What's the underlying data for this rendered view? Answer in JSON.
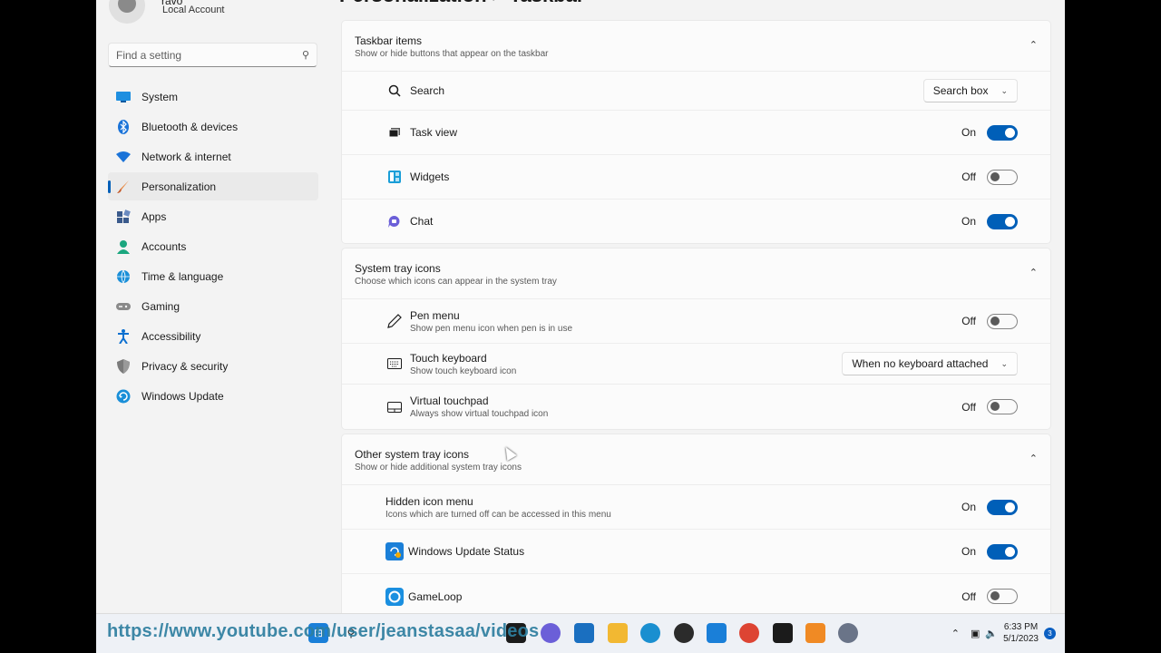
{
  "account": {
    "name": "ravo",
    "type": "Local Account"
  },
  "page_title": "Personalization  >  Taskbar",
  "search": {
    "placeholder": "Find a setting"
  },
  "sidebar": {
    "items": [
      {
        "label": "System",
        "icon": "monitor-icon",
        "color": "#0078d4"
      },
      {
        "label": "Bluetooth & devices",
        "icon": "bluetooth-icon",
        "color": "#0078d4"
      },
      {
        "label": "Network & internet",
        "icon": "wifi-icon",
        "color": "#0078d4"
      },
      {
        "label": "Personalization",
        "icon": "brush-icon",
        "color": "#e8833a",
        "active": true
      },
      {
        "label": "Apps",
        "icon": "apps-icon",
        "color": "#3a5a8c"
      },
      {
        "label": "Accounts",
        "icon": "person-icon",
        "color": "#1aa67e"
      },
      {
        "label": "Time & language",
        "icon": "globe-clock-icon",
        "color": "#0078d4"
      },
      {
        "label": "Gaming",
        "icon": "controller-icon",
        "color": "#8a8a8a"
      },
      {
        "label": "Accessibility",
        "icon": "accessibility-icon",
        "color": "#0078d4"
      },
      {
        "label": "Privacy & security",
        "icon": "shield-icon",
        "color": "#7a7a7a"
      },
      {
        "label": "Windows Update",
        "icon": "update-icon",
        "color": "#0078d4"
      }
    ]
  },
  "sections": {
    "taskbar_items": {
      "title": "Taskbar items",
      "subtitle": "Show or hide buttons that appear on the taskbar",
      "rows": [
        {
          "label": "Search",
          "control": "dropdown",
          "value": "Search box"
        },
        {
          "label": "Task view",
          "state": "On"
        },
        {
          "label": "Widgets",
          "state": "Off"
        },
        {
          "label": "Chat",
          "state": "On"
        }
      ]
    },
    "system_tray": {
      "title": "System tray icons",
      "subtitle": "Choose which icons can appear in the system tray",
      "rows": [
        {
          "label": "Pen menu",
          "desc": "Show pen menu icon when pen is in use",
          "state": "Off"
        },
        {
          "label": "Touch keyboard",
          "desc": "Show touch keyboard icon",
          "control": "dropdown",
          "value": "When no keyboard attached"
        },
        {
          "label": "Virtual touchpad",
          "desc": "Always show virtual touchpad icon",
          "state": "Off"
        }
      ]
    },
    "other_tray": {
      "title": "Other system tray icons",
      "subtitle": "Show or hide additional system tray icons",
      "rows": [
        {
          "label": "Hidden icon menu",
          "desc": "Icons which are turned off can be accessed in this menu",
          "state": "On"
        },
        {
          "label": "Windows Update Status",
          "state": "On"
        },
        {
          "label": "GameLoop",
          "state": "Off"
        }
      ]
    }
  },
  "taskbar": {
    "overlay_url": "https://www.youtube.com/user/jeanstasaa/videos",
    "time": "6:33 PM",
    "date": "5/1/2023",
    "notification_count": "3"
  },
  "colors": {
    "accent": "#005fb8",
    "background": "#f3f3f3",
    "card": "#fbfbfb"
  }
}
